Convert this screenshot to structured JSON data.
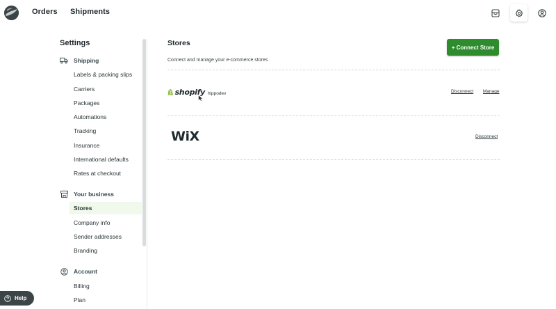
{
  "topnav": {
    "logo_icon": "globe-logo-icon",
    "items": [
      {
        "label": "Orders"
      },
      {
        "label": "Shipments"
      }
    ],
    "icons": [
      "package-icon",
      "gear-icon",
      "user-circle-icon"
    ]
  },
  "sidebar": {
    "title": "Settings",
    "sections": [
      {
        "icon": "truck-icon",
        "heading": "Shipping",
        "items": [
          "Labels & packing slips",
          "Carriers",
          "Packages",
          "Automations",
          "Tracking",
          "Insurance",
          "International defaults",
          "Rates at checkout"
        ]
      },
      {
        "icon": "store-icon",
        "heading": "Your business",
        "items": [
          "Stores",
          "Company info",
          "Sender addresses",
          "Branding"
        ]
      },
      {
        "icon": "account-circle-icon",
        "heading": "Account",
        "items": [
          "Billing",
          "Plan"
        ]
      }
    ],
    "active_item": "Stores"
  },
  "main": {
    "title": "Stores",
    "subtitle": "Connect and manage your e-commerce stores",
    "connect_button": "+ Connect Store",
    "stores": [
      {
        "platform": "shopify",
        "logo_text": "shopify",
        "name": "hippodev",
        "actions": [
          "Disconnect",
          "Manage"
        ]
      },
      {
        "platform": "wix",
        "logo_text": "WiX",
        "name": "",
        "actions": [
          "Disconnect"
        ]
      }
    ]
  },
  "help": {
    "label": "Help",
    "icon": "question-circle-icon"
  },
  "colors": {
    "accent_green": "#2e8b2e",
    "active_bg": "#f1f8ec",
    "dark": "#3b4447",
    "shopify_green": "#95bf47"
  }
}
